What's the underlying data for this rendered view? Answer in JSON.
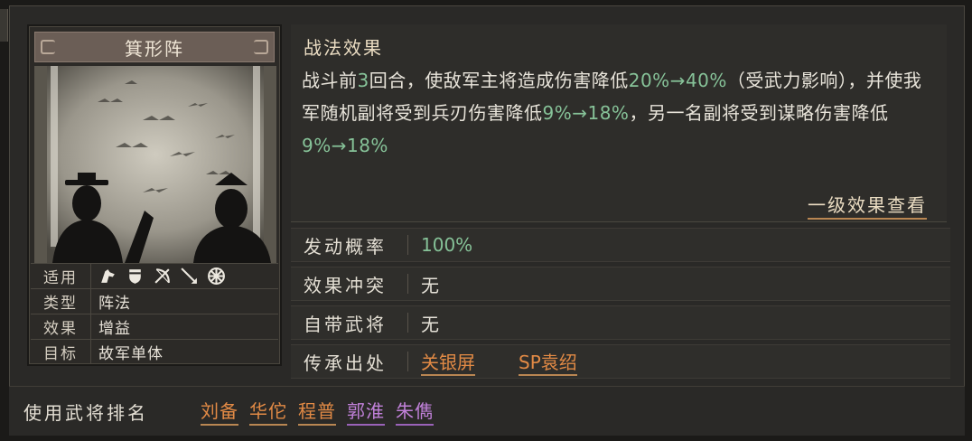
{
  "card": {
    "title": "箕形阵",
    "attrs": [
      {
        "key": "适用",
        "icons": [
          "cavalry-icon",
          "shield-icon",
          "bow-icon",
          "spear-icon",
          "wheel-icon"
        ]
      },
      {
        "key": "类型",
        "value": "阵法"
      },
      {
        "key": "效果",
        "value": "增益"
      },
      {
        "key": "目标",
        "value": "故军单体"
      }
    ]
  },
  "effect": {
    "title": "战法效果",
    "segments": [
      {
        "text": "战斗前",
        "hl": false
      },
      {
        "text": "3",
        "hl": true
      },
      {
        "text": "回合，使敌军主将造成伤害降低",
        "hl": false
      },
      {
        "text": "20%→40%",
        "hl": true
      },
      {
        "text": "（受武力影响），并使我军随机副将受到兵刃伤害降低",
        "hl": false
      },
      {
        "text": "9%→18%",
        "hl": true
      },
      {
        "text": "，另一名副将受到谋略伤害降低",
        "hl": false
      },
      {
        "text": "9%→18%",
        "hl": true
      }
    ],
    "link_label": "一级效果查看"
  },
  "props": [
    {
      "key": "发动概率",
      "value": "100%",
      "style": "green"
    },
    {
      "key": "效果冲突",
      "value": "无",
      "style": "plain"
    },
    {
      "key": "自带武将",
      "value": "无",
      "style": "plain"
    },
    {
      "key": "传承出处",
      "values": [
        "关银屏",
        "SP袁绍"
      ],
      "style": "orange"
    }
  ],
  "ranking": {
    "label": "使用武将排名",
    "generals": [
      {
        "name": "刘备",
        "color": "orange"
      },
      {
        "name": "华佗",
        "color": "orange"
      },
      {
        "name": "程普",
        "color": "orange"
      },
      {
        "name": "郭淮",
        "color": "purple"
      },
      {
        "name": "朱儁",
        "color": "purple"
      }
    ]
  },
  "colors": {
    "highlight": "#86c298",
    "orange": "#e28a45",
    "purple": "#c080d8",
    "underline": "#b98652"
  }
}
